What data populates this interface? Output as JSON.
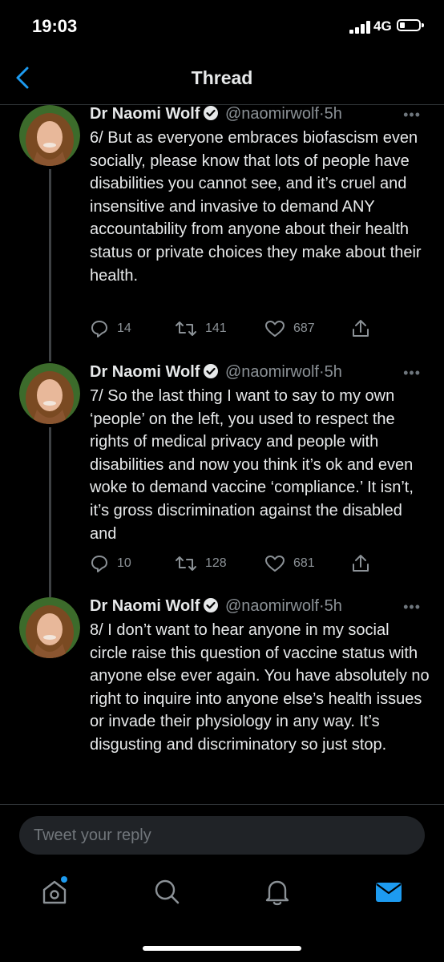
{
  "status_bar": {
    "time": "19:03",
    "network": "4G"
  },
  "header": {
    "title": "Thread"
  },
  "tweets": [
    {
      "name": "Dr Naomi Wolf",
      "handle": "@naomirwolf",
      "separator": "·",
      "time": "5h",
      "text": "6/ But as everyone embraces biofascism even socially, please know that lots of people have disabilities you cannot see, and it’s cruel and insensitive and invasive to demand ANY accountability from anyone about their health status or private choices they make about their health.",
      "replies": "14",
      "retweets": "141",
      "likes": "687"
    },
    {
      "name": "Dr Naomi Wolf",
      "handle": "@naomirwolf",
      "separator": "·",
      "time": "5h",
      "text": "7/ So the last thing I want to say to my own ‘people’ on the left, you used to respect the rights of medical privacy and people with disabilities and now you think it’s ok and even woke to demand vaccine ‘compliance.’ It isn’t, it’s gross discrimination against the disabled and",
      "replies": "10",
      "retweets": "128",
      "likes": "681"
    },
    {
      "name": "Dr Naomi Wolf",
      "handle": "@naomirwolf",
      "separator": "·",
      "time": "5h",
      "text": "8/ I don’t want to hear anyone in my social circle raise this question of vaccine status with anyone else ever again. You have absolutely no right to inquire into anyone else’s health issues or invade their physiology in any way. It’s disgusting and discriminatory so just stop."
    }
  ],
  "reply_bar": {
    "placeholder": "Tweet your reply"
  },
  "tabs": [
    "home-icon",
    "search-icon",
    "notifications-icon",
    "messages-icon"
  ],
  "colors": {
    "accent": "#1d9bf0",
    "background": "#000000",
    "secondary_text": "#8b9196"
  }
}
